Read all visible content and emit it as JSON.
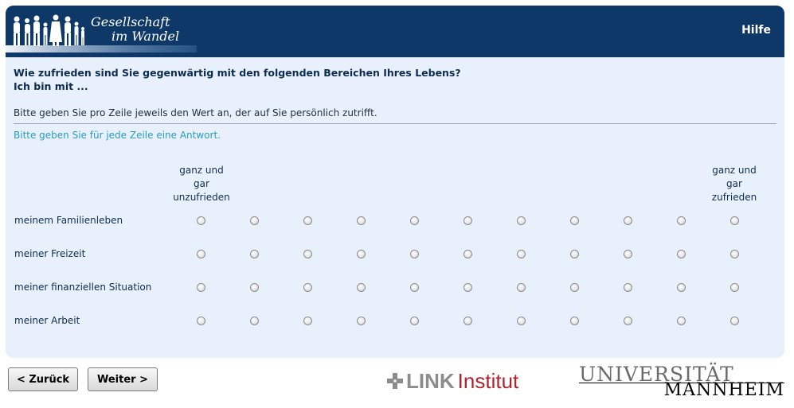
{
  "header": {
    "logo_line1": "Gesellschaft",
    "logo_line2": "im Wandel",
    "help_label": "Hilfe",
    "background_color": "#0d3868"
  },
  "question": {
    "line1": "Wie zufrieden sind Sie gegenwärtig mit den folgenden Bereichen Ihres Lebens?",
    "line2": "Ich bin mit ...",
    "instruction": "Bitte geben Sie pro Zeile jeweils den Wert an, der auf Sie persönlich zutrifft.",
    "hint": "Bitte geben Sie für jede Zeile eine Antwort.",
    "hint_color": "#2a9bc8"
  },
  "scale": {
    "low_line1": "ganz und",
    "low_line2": "gar",
    "low_line3": "unzufrieden",
    "high_line1": "ganz und",
    "high_line2": "gar",
    "high_line3": "zufrieden",
    "points": 11
  },
  "rows": [
    {
      "label": "meinem Familienleben"
    },
    {
      "label": "meiner Freizeit"
    },
    {
      "label": "meiner finanziellen Situation"
    },
    {
      "label": "meiner Arbeit"
    }
  ],
  "nav": {
    "back_label": "< Zurück",
    "next_label": "Weiter >"
  },
  "footer": {
    "link_word": "LINK",
    "institut_word": "Institut",
    "uni_top": "UNIVERSITÄT",
    "uni_bottom": "MANNHEIM"
  }
}
